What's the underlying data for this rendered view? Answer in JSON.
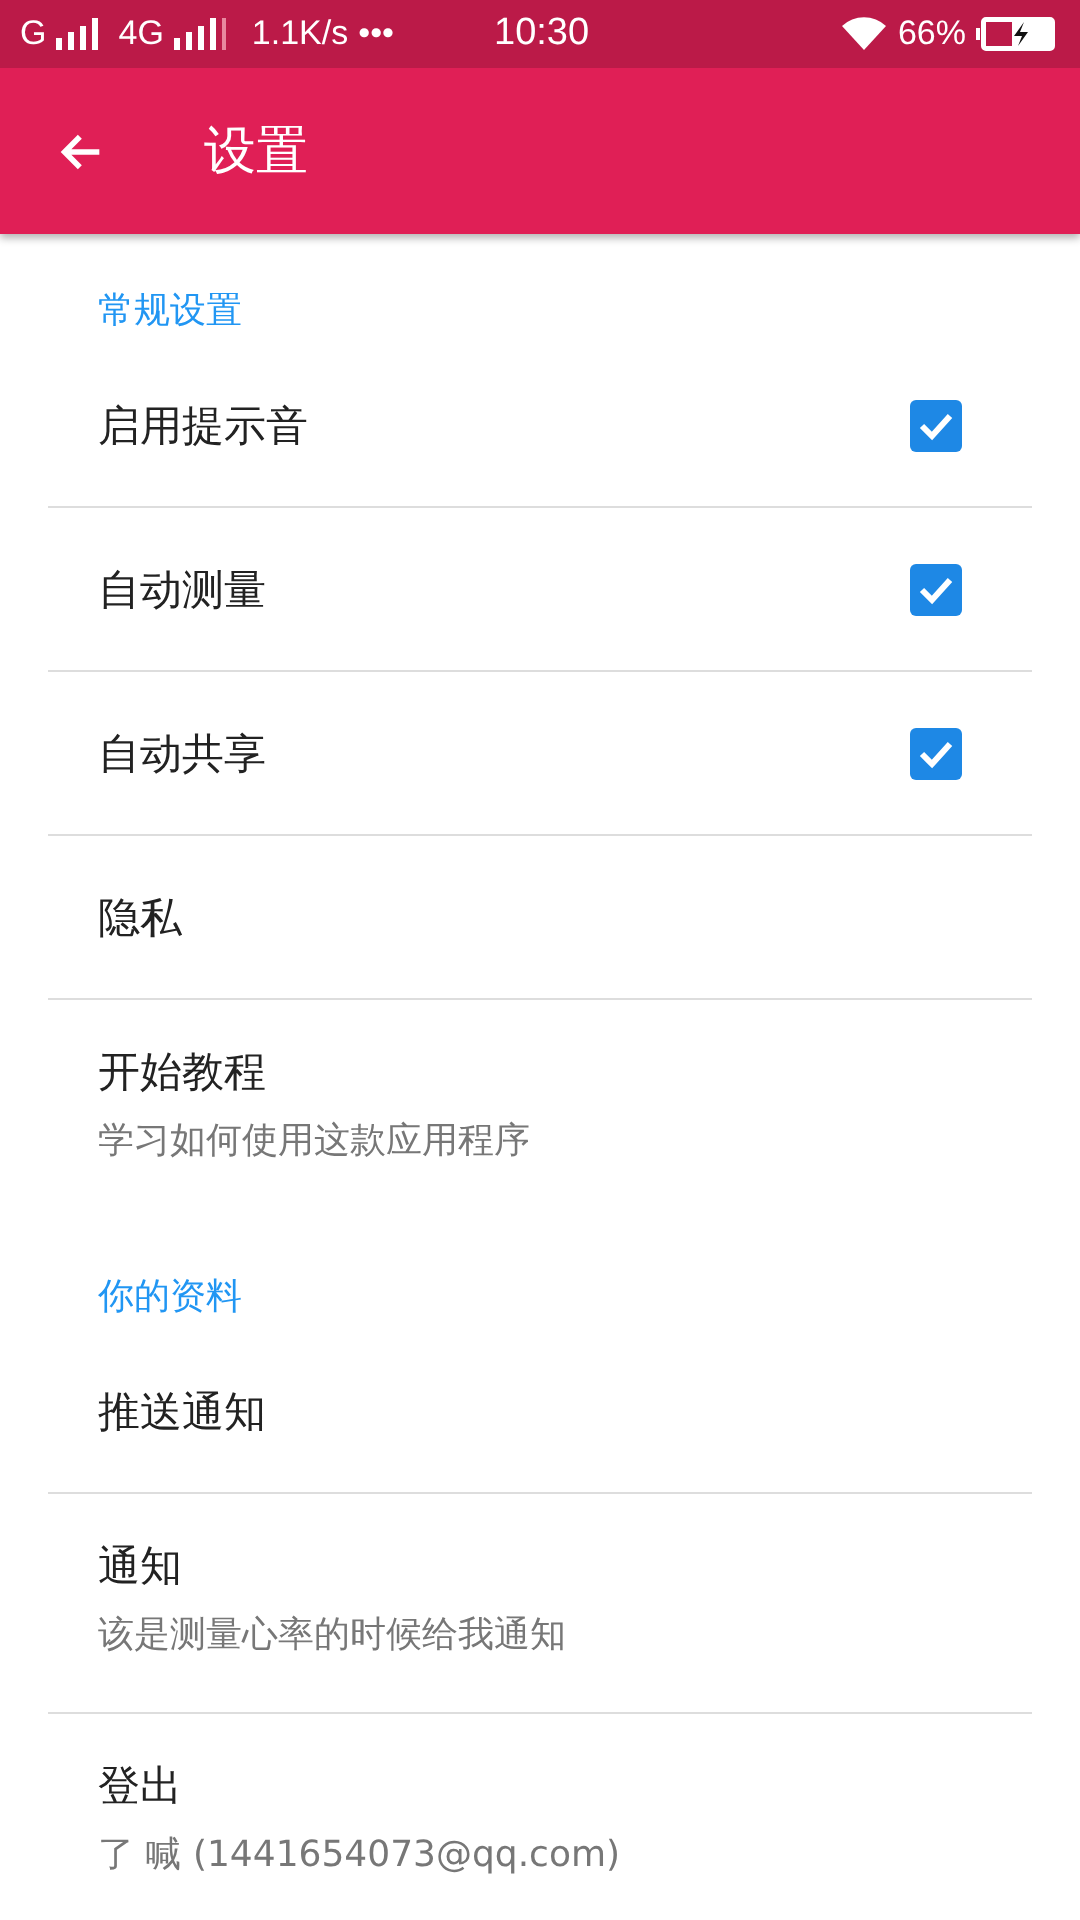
{
  "status_bar": {
    "network_1": "G",
    "network_2": "4G",
    "speed": "1.1K/s",
    "more": "•••",
    "time": "10:30",
    "battery": "66%"
  },
  "app_bar": {
    "title": "设置"
  },
  "sections": [
    {
      "header": "常规设置",
      "items": [
        {
          "kind": "checkbox",
          "title": "启用提示音",
          "checked": true
        },
        {
          "kind": "checkbox",
          "title": "自动测量",
          "checked": true
        },
        {
          "kind": "checkbox",
          "title": "自动共享",
          "checked": true
        },
        {
          "kind": "plain",
          "title": "隐私"
        },
        {
          "kind": "plain",
          "title": "开始教程",
          "subtitle": "学习如何使用这款应用程序"
        }
      ]
    },
    {
      "header": "你的资料",
      "items": [
        {
          "kind": "plain",
          "title": "推送通知"
        },
        {
          "kind": "plain",
          "title": "通知",
          "subtitle": "该是测量心率的时候给我通知"
        },
        {
          "kind": "plain",
          "title": "登出",
          "subtitle": "了 喊 (1441654073@qq.com)"
        }
      ]
    }
  ]
}
